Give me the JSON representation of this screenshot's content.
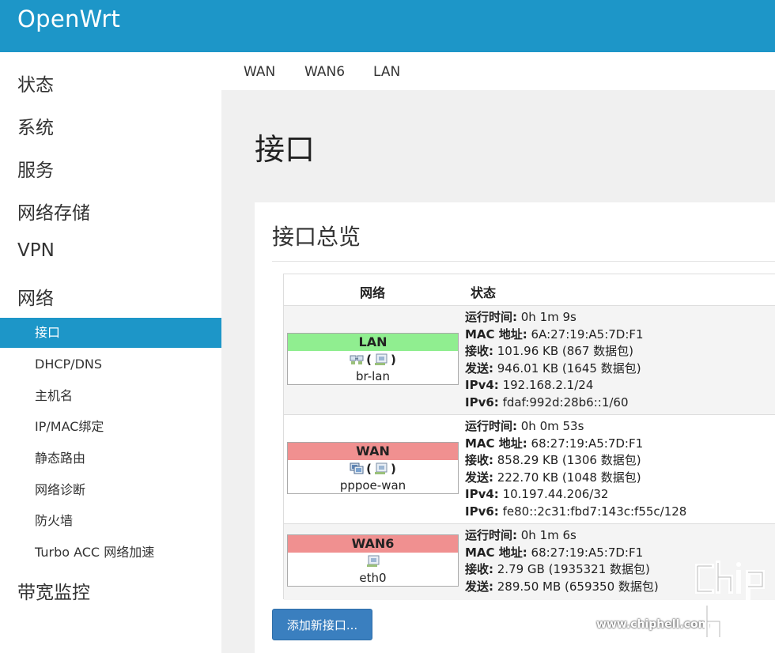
{
  "app": {
    "brand": "OpenWrt"
  },
  "sidebar": {
    "top_items": [
      {
        "label": "状态"
      },
      {
        "label": "系统"
      },
      {
        "label": "服务"
      },
      {
        "label": "网络存储"
      },
      {
        "label": "VPN"
      },
      {
        "label": "网络"
      }
    ],
    "sub_items": [
      {
        "label": "接口",
        "active": true
      },
      {
        "label": "DHCP/DNS"
      },
      {
        "label": "主机名"
      },
      {
        "label": "IP/MAC绑定"
      },
      {
        "label": "静态路由"
      },
      {
        "label": "网络诊断"
      },
      {
        "label": "防火墙"
      },
      {
        "label": "Turbo ACC 网络加速"
      }
    ],
    "bottom_item": {
      "label": "带宽监控"
    }
  },
  "tabs": [
    {
      "label": "WAN"
    },
    {
      "label": "WAN6"
    },
    {
      "label": "LAN"
    }
  ],
  "page": {
    "title": "接口"
  },
  "panel": {
    "title": "接口总览",
    "columns": {
      "network": "网络",
      "status": "状态"
    },
    "interfaces": [
      {
        "name": "LAN",
        "header_color": "#90ee90",
        "icons": [
          "bridge-icon",
          "ethernet-port-icon"
        ],
        "device": "br-lan",
        "status": [
          {
            "key": "运行时间:",
            "value": " 0h 1m 9s"
          },
          {
            "key": "MAC 地址:",
            "value": " 6A:27:19:A5:7D:F1"
          },
          {
            "key": "接收:",
            "value": " 101.96 KB (867 数据包)"
          },
          {
            "key": "发送:",
            "value": " 946.01 KB (1645 数据包)"
          },
          {
            "key": "IPv4:",
            "value": " 192.168.2.1/24"
          },
          {
            "key": "IPv6:",
            "value": " fdaf:992d:28b6::1/60"
          }
        ]
      },
      {
        "name": "WAN",
        "header_color": "#f09090",
        "icons": [
          "pppoe-icon",
          "ethernet-port-icon"
        ],
        "device": "pppoe-wan",
        "status": [
          {
            "key": "运行时间:",
            "value": " 0h 0m 53s"
          },
          {
            "key": "MAC 地址:",
            "value": " 68:27:19:A5:7D:F1"
          },
          {
            "key": "接收:",
            "value": " 858.29 KB (1306 数据包)"
          },
          {
            "key": "发送:",
            "value": " 222.70 KB (1048 数据包)"
          },
          {
            "key": "IPv4:",
            "value": " 10.197.44.206/32"
          },
          {
            "key": "IPv6:",
            "value": " fe80::2c31:fbd7:143c:f55c/128"
          }
        ]
      },
      {
        "name": "WAN6",
        "header_color": "#f09090",
        "icons": [
          "ethernet-port-icon"
        ],
        "device": "eth0",
        "status": [
          {
            "key": "运行时间:",
            "value": " 0h 1m 6s"
          },
          {
            "key": "MAC 地址:",
            "value": " 68:27:19:A5:7D:F1"
          },
          {
            "key": "接收:",
            "value": " 2.79 GB (1935321 数据包)"
          },
          {
            "key": "发送:",
            "value": " 289.50 MB (659350 数据包)"
          }
        ]
      }
    ],
    "add_button": "添加新接口..."
  },
  "watermark": {
    "url": "www.chiphell.com",
    "logo_text": "chiphell"
  },
  "colors": {
    "accent": "#1d96c8",
    "button": "#3a7fbf",
    "up": "#90ee90",
    "down": "#f09090"
  }
}
